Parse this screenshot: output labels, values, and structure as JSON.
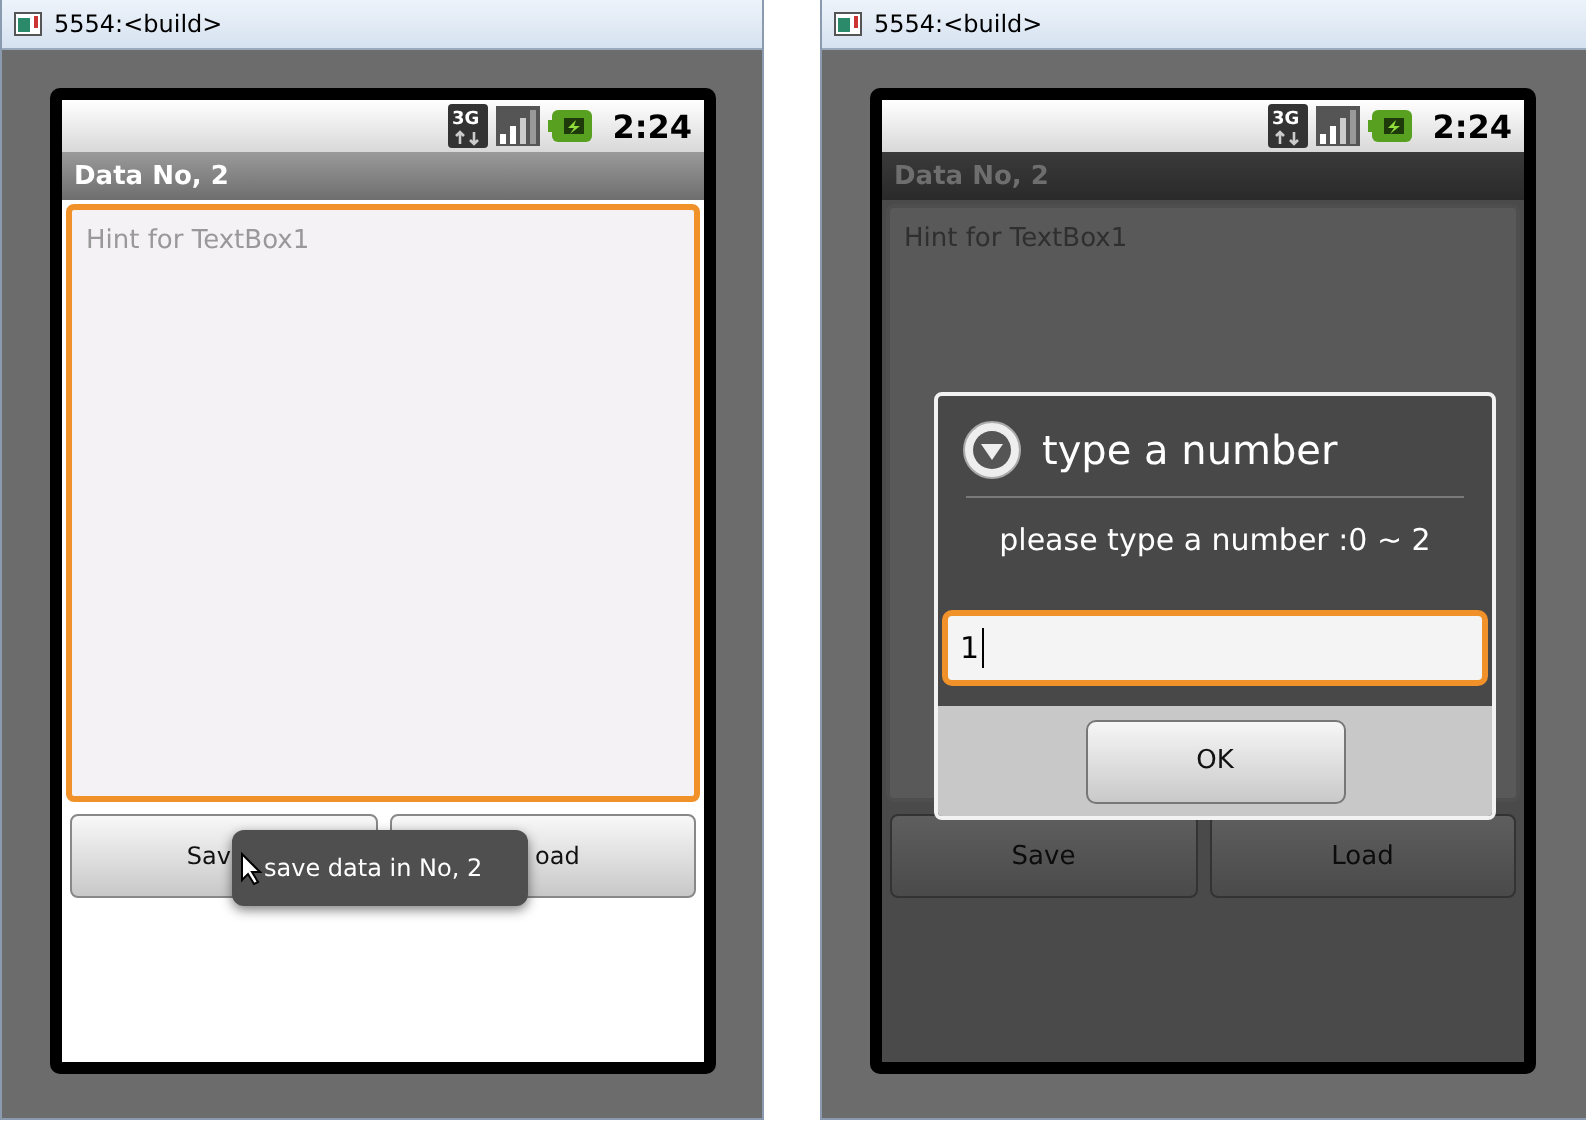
{
  "windows": [
    {
      "title": "5554:<build>",
      "dimmed": false,
      "status_bar": {
        "network": "3G",
        "time": "2:24"
      },
      "app_title": "Data No, 2",
      "textbox": {
        "placeholder": "Hint for TextBox1",
        "focused": true
      },
      "buttons": [
        "Sav",
        "oad"
      ],
      "toast": {
        "text": "save data in No, 2"
      }
    },
    {
      "title": "5554:<build>",
      "dimmed": true,
      "status_bar": {
        "network": "3G",
        "time": "2:24"
      },
      "app_title": "Data No, 2",
      "textbox": {
        "placeholder": "Hint for TextBox1",
        "focused": false
      },
      "buttons": [
        "Save",
        "Load"
      ],
      "dialog": {
        "title": "type a number",
        "message": "please type a number :0 ~ 2",
        "value": "1",
        "focused": true,
        "button": "OK"
      }
    }
  ]
}
